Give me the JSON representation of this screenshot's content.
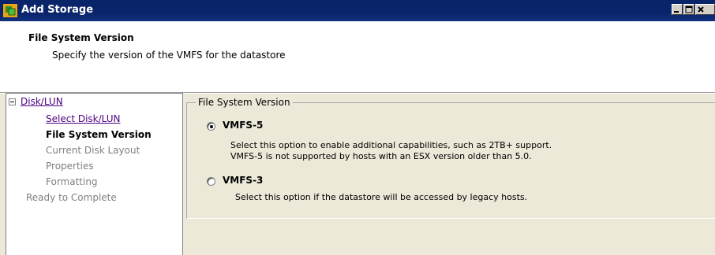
{
  "window": {
    "title": "Add Storage",
    "icon": "vmware-app-icon",
    "buttons": [
      "minimize-icon",
      "maximize-icon",
      "close-icon"
    ]
  },
  "header": {
    "title": "File System Version",
    "subtitle": "Specify the version of the VMFS for the datastore"
  },
  "nav": {
    "root_label": "Disk/LUN",
    "items": [
      {
        "label": "Select Disk/LUN",
        "state": "link"
      },
      {
        "label": "File System Version",
        "state": "current"
      },
      {
        "label": "Current Disk Layout",
        "state": "disabled"
      },
      {
        "label": "Properties",
        "state": "disabled"
      },
      {
        "label": "Formatting",
        "state": "disabled"
      }
    ],
    "final_label": "Ready to Complete"
  },
  "group": {
    "legend": "File System Version",
    "options": [
      {
        "label": "VMFS-5",
        "checked": true,
        "desc_line1": "Select this option to enable additional capabilities, such as 2TB+ support.",
        "desc_line2": "VMFS-5 is not supported by hosts with an ESX version older than 5.0."
      },
      {
        "label": "VMFS-3",
        "checked": false,
        "desc_line1": "Select this option if the datastore will be accessed by legacy hosts."
      }
    ]
  },
  "colors": {
    "titlebar": "#0a246a",
    "link": "#4b0082",
    "dialog_bg": "#ece9d8"
  }
}
